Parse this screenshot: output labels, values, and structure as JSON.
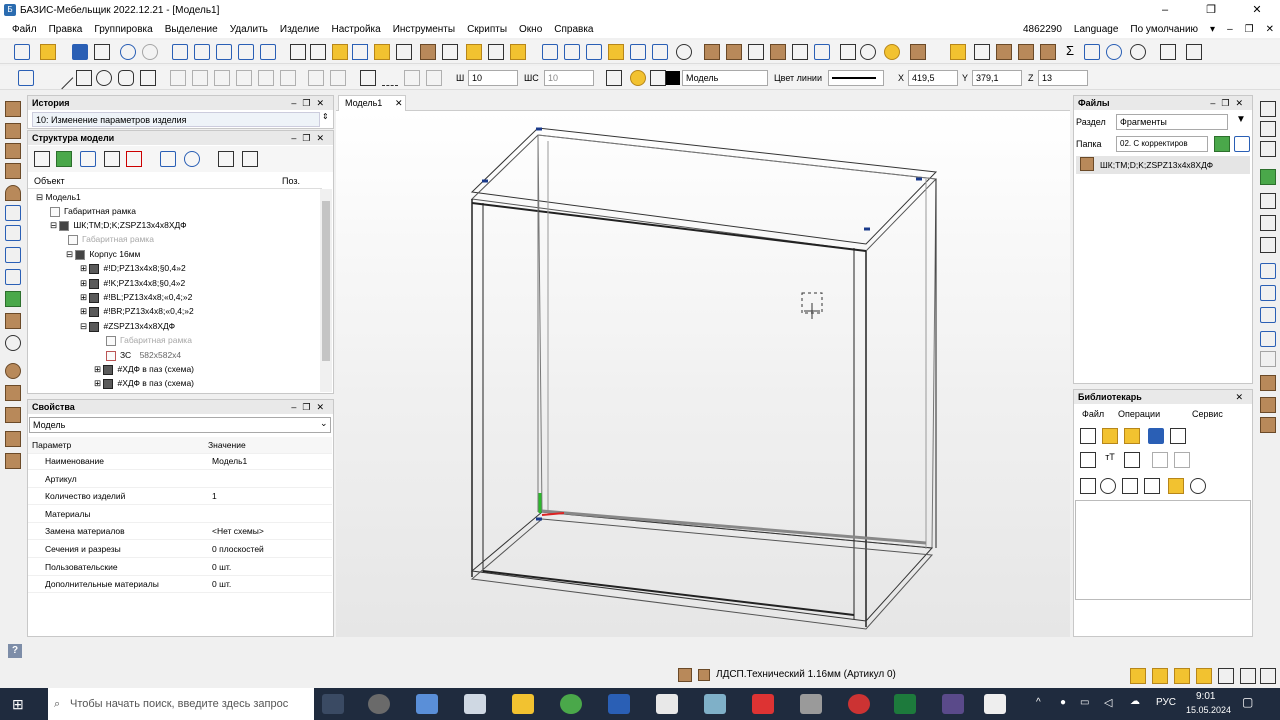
{
  "window": {
    "title": "БАЗИС-Мебельщик 2022.12.21 - [Модель1]",
    "controls": [
      "–",
      "❐",
      "✕"
    ]
  },
  "menu": {
    "items": [
      "Файл",
      "Правка",
      "Группировка",
      "Выделение",
      "Удалить",
      "Изделие",
      "Настройка",
      "Инструменты",
      "Скрипты",
      "Окно",
      "Справка"
    ],
    "license": "4862290",
    "language": "Language",
    "preset": "По умолчанию"
  },
  "toolbar2": {
    "sh_label": "Ш",
    "sh_value": "10",
    "shs_label": "ШС",
    "shs_value": "10",
    "layer_color": "#000000",
    "layer": "Модель",
    "line_color_label": "Цвет линии",
    "x_label": "X",
    "x_value": "419,5",
    "y_label": "Y",
    "y_value": "379,1",
    "z_value": "13"
  },
  "history": {
    "title": "История",
    "current": "10:  Изменение параметров изделия"
  },
  "structure": {
    "title": "Структура модели",
    "col_object": "Объект",
    "col_pos": "Поз.",
    "rows": [
      {
        "text": "Модель1",
        "dim": false
      },
      {
        "text": "Габаритная рамка",
        "dim": false
      },
      {
        "text": "ШК;ТМ;D;K;ZSPZ13x4x8ХДФ",
        "dim": false
      },
      {
        "text": "Габаритная рамка",
        "dim": true
      },
      {
        "text": "Корпус 16мм",
        "dim": false
      },
      {
        "text": "#!D;PZ13x4x8;§0,4»2",
        "dim": false
      },
      {
        "text": "#!K;PZ13x4x8;§0,4»2",
        "dim": false
      },
      {
        "text": "#!BL;PZ13x4x8;«0,4;»2",
        "dim": false
      },
      {
        "text": "#!BR;PZ13x4x8;«0,4;»2",
        "dim": false
      },
      {
        "text": "#ZSPZ13x4x8ХДФ",
        "dim": false
      },
      {
        "text": "Габаритная рамка",
        "dim": true
      },
      {
        "text": "ЗС",
        "extra": "582x582x4",
        "dim": false
      },
      {
        "text": "#ХДФ в паз (схема)",
        "dim": false
      },
      {
        "text": "#ХДФ в паз (схема)",
        "dim": false
      }
    ]
  },
  "properties": {
    "title": "Свойства",
    "selector": "Модель",
    "col_param": "Параметр",
    "col_value": "Значение",
    "rows": [
      {
        "name": "Наименование",
        "value": "Модель1"
      },
      {
        "name": "Артикул",
        "value": ""
      },
      {
        "name": "Количество изделий",
        "value": "1"
      },
      {
        "name": "Материалы",
        "value": ""
      },
      {
        "name": "Замена материалов",
        "value": "<Нет схемы>"
      },
      {
        "name": "Сечения и разрезы",
        "value": "0 плоскостей"
      },
      {
        "name": "Пользовательские",
        "value": "0 шт."
      },
      {
        "name": "Дополнительные материалы",
        "value": "0 шт."
      }
    ]
  },
  "tabs": [
    "Модель1"
  ],
  "files": {
    "title": "Файлы",
    "section_label": "Раздел",
    "section_value": "Фрагменты",
    "folder_label": "Папка",
    "folder_value": "02. С корректиров",
    "items": [
      "ШК;ТМ;D;K;ZSPZ13x4x8ХДФ"
    ]
  },
  "librarian": {
    "title": "Библиотекарь",
    "menu": [
      "Файл",
      "Операции",
      "Сервис"
    ]
  },
  "status": {
    "material": "ЛДСП.Технический 1.16мм (Артикул 0)",
    "help": "?"
  },
  "taskbar": {
    "search_placeholder": "Чтобы начать поиск, введите здесь запрос",
    "lang": "РУС",
    "time": "9:01",
    "date": "15.05.2024"
  }
}
